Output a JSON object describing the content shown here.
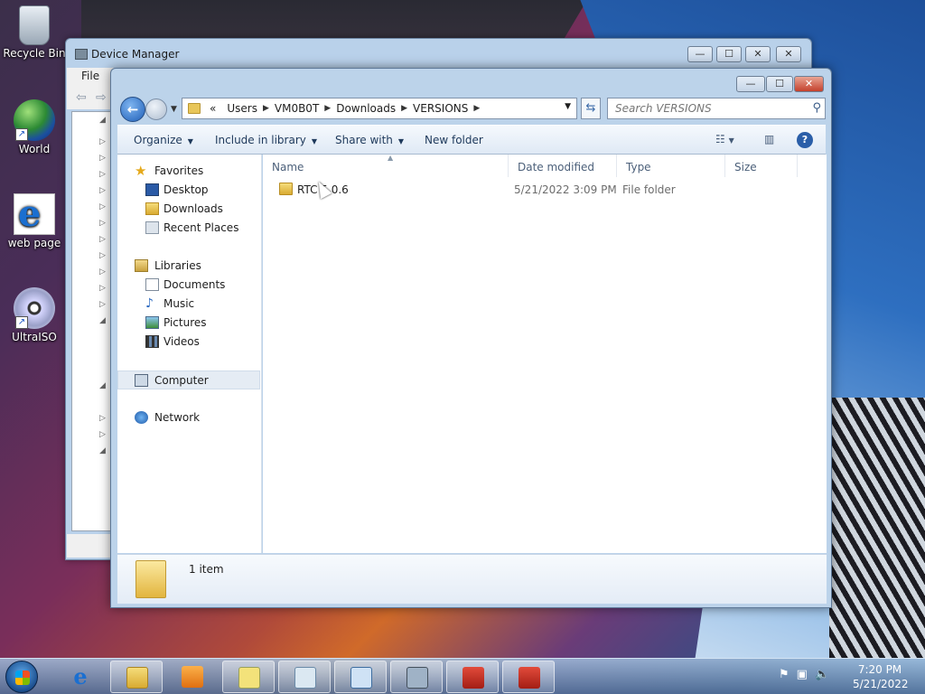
{
  "desktop": {
    "icons": [
      {
        "label": "Recycle Bin",
        "icon": "recycle-bin-icon"
      },
      {
        "label": "World",
        "icon": "globe-icon"
      },
      {
        "label": "web page",
        "icon": "internet-explorer-icon"
      },
      {
        "label": "UltraISO",
        "icon": "disc-icon"
      }
    ]
  },
  "device_manager": {
    "title": "Device Manager",
    "menu": {
      "file": "File"
    },
    "buttons": {
      "minimize": "—",
      "maximize": "☐",
      "close": "✕"
    }
  },
  "explorer": {
    "buttons": {
      "minimize": "—",
      "maximize": "☐",
      "close": "✕"
    },
    "address": {
      "overflow": "«",
      "crumbs": [
        "Users",
        "VM0B0T",
        "Downloads",
        "VERSIONS"
      ]
    },
    "search": {
      "placeholder": "Search VERSIONS"
    },
    "command_bar": {
      "organize": "Organize",
      "include_in_library": "Include in library",
      "share_with": "Share with",
      "new_folder": "New folder"
    },
    "nav": {
      "favorites": "Favorites",
      "desktop": "Desktop",
      "downloads": "Downloads",
      "recent_places": "Recent Places",
      "libraries": "Libraries",
      "documents": "Documents",
      "music": "Music",
      "pictures": "Pictures",
      "videos": "Videos",
      "computer": "Computer",
      "network": "Network"
    },
    "columns": {
      "name": "Name",
      "date_modified": "Date modified",
      "type": "Type",
      "size": "Size"
    },
    "files": [
      {
        "name": "RTC 5.0.6",
        "date_modified": "5/21/2022 3:09 PM",
        "type": "File folder",
        "size": ""
      }
    ],
    "status": {
      "item_count": "1 item"
    }
  },
  "taskbar": {
    "clock_time": "7:20 PM",
    "clock_date": "5/21/2022"
  },
  "colors": {
    "accent": "#1f5fb8",
    "titlebar": "#bcd3ea",
    "close_red": "#c4402c"
  }
}
